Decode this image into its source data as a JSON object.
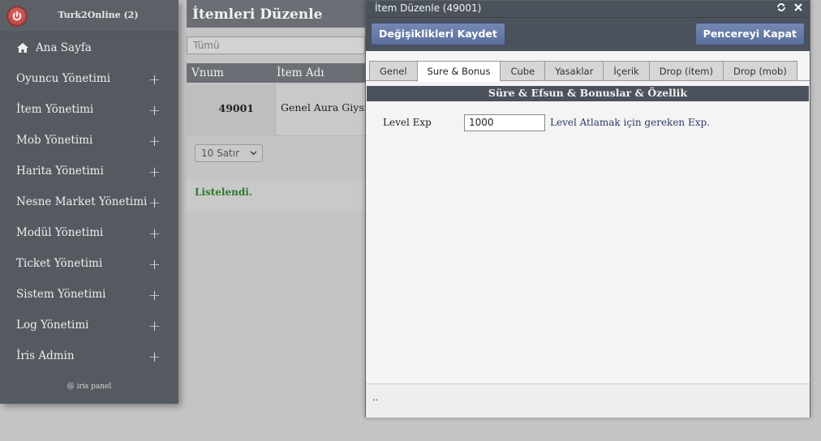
{
  "sidebar": {
    "title": "Turk2Online (2)",
    "logo_icon": "power-icon",
    "home_label": "Ana Sayfa",
    "items": [
      {
        "label": "Oyuncu Yönetimi"
      },
      {
        "label": "İtem Yönetimi"
      },
      {
        "label": "Mob Yönetimi"
      },
      {
        "label": "Harita Yönetimi"
      },
      {
        "label": "Nesne Market Yönetimi"
      },
      {
        "label": "Modül Yönetimi"
      },
      {
        "label": "Ticket Yönetimi"
      },
      {
        "label": "Sistem Yönetimi"
      },
      {
        "label": "Log Yönetimi"
      },
      {
        "label": "İris Admin"
      }
    ],
    "expand_symbol": "+",
    "footer": "@ iris panel"
  },
  "main": {
    "title": "İtemleri Düzenle",
    "filter_value": "Tümü",
    "table": {
      "columns": [
        "Vnum",
        "İtem Adı"
      ],
      "rows": [
        {
          "vnum": "49001",
          "name": "Genel Aura Giysisi"
        }
      ]
    },
    "rows_select": "10 Satır",
    "status": "Listelendi."
  },
  "dialog": {
    "title": "İtem Düzenle (49001)",
    "save_button": "Değişiklikleri Kaydet",
    "close_button": "Pencereyi Kapat",
    "tabs": [
      {
        "label": "Genel"
      },
      {
        "label": "Sure & Bonus"
      },
      {
        "label": "Cube"
      },
      {
        "label": "Yasaklar"
      },
      {
        "label": "İçerik"
      },
      {
        "label": "Drop (item)"
      },
      {
        "label": "Drop (mob)"
      }
    ],
    "active_tab": "Sure & Bonus",
    "section_title": "Süre & Efsun & Bonuslar & Özellik",
    "fields": [
      {
        "label": "Level Exp",
        "value": "1000",
        "hint": "Level Atlamak için gereken Exp."
      }
    ],
    "footer_text": ".."
  },
  "colors": {
    "sidebar_bg": "#555a61",
    "header_bg": "#4b525b",
    "button_bg": "#5b6f9c",
    "status_green": "#2c7a2c"
  }
}
